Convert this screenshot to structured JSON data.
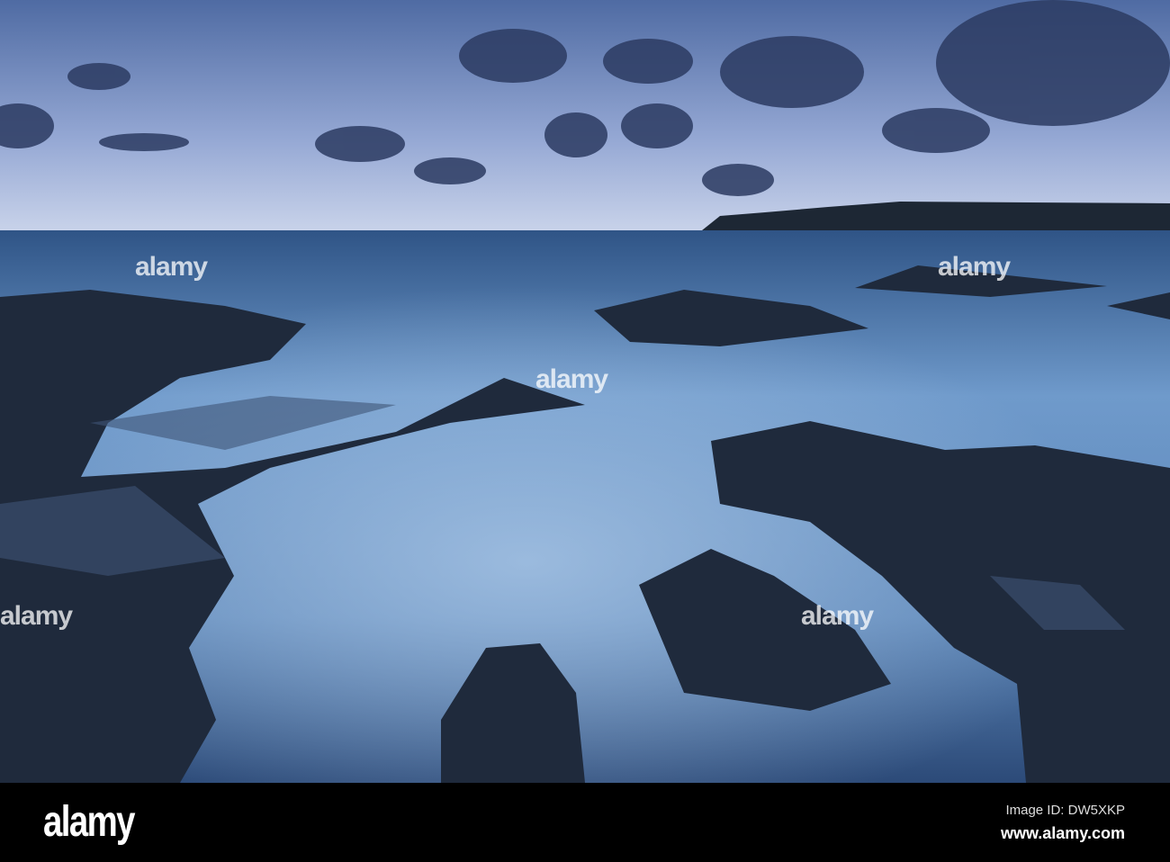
{
  "colors": {
    "sky_top": "#5a74a8",
    "sky_horizon": "#c7d2ea",
    "sea": "#5e86b8",
    "rock": "#1f2a3c"
  },
  "watermark": {
    "text": "alamy"
  },
  "footer": {
    "logo": "alamy",
    "image_id": "Image ID: DW5XKP",
    "url": "www.alamy.com"
  }
}
